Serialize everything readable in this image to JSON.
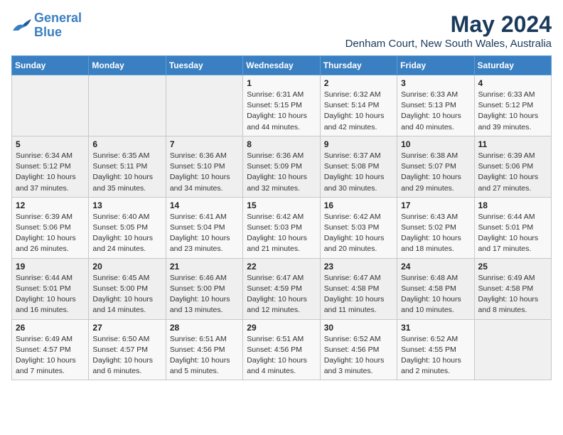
{
  "logo": {
    "line1": "General",
    "line2": "Blue"
  },
  "title": "May 2024",
  "location": "Denham Court, New South Wales, Australia",
  "days_of_week": [
    "Sunday",
    "Monday",
    "Tuesday",
    "Wednesday",
    "Thursday",
    "Friday",
    "Saturday"
  ],
  "weeks": [
    [
      {
        "day": "",
        "info": ""
      },
      {
        "day": "",
        "info": ""
      },
      {
        "day": "",
        "info": ""
      },
      {
        "day": "1",
        "info": "Sunrise: 6:31 AM\nSunset: 5:15 PM\nDaylight: 10 hours\nand 44 minutes."
      },
      {
        "day": "2",
        "info": "Sunrise: 6:32 AM\nSunset: 5:14 PM\nDaylight: 10 hours\nand 42 minutes."
      },
      {
        "day": "3",
        "info": "Sunrise: 6:33 AM\nSunset: 5:13 PM\nDaylight: 10 hours\nand 40 minutes."
      },
      {
        "day": "4",
        "info": "Sunrise: 6:33 AM\nSunset: 5:12 PM\nDaylight: 10 hours\nand 39 minutes."
      }
    ],
    [
      {
        "day": "5",
        "info": "Sunrise: 6:34 AM\nSunset: 5:12 PM\nDaylight: 10 hours\nand 37 minutes."
      },
      {
        "day": "6",
        "info": "Sunrise: 6:35 AM\nSunset: 5:11 PM\nDaylight: 10 hours\nand 35 minutes."
      },
      {
        "day": "7",
        "info": "Sunrise: 6:36 AM\nSunset: 5:10 PM\nDaylight: 10 hours\nand 34 minutes."
      },
      {
        "day": "8",
        "info": "Sunrise: 6:36 AM\nSunset: 5:09 PM\nDaylight: 10 hours\nand 32 minutes."
      },
      {
        "day": "9",
        "info": "Sunrise: 6:37 AM\nSunset: 5:08 PM\nDaylight: 10 hours\nand 30 minutes."
      },
      {
        "day": "10",
        "info": "Sunrise: 6:38 AM\nSunset: 5:07 PM\nDaylight: 10 hours\nand 29 minutes."
      },
      {
        "day": "11",
        "info": "Sunrise: 6:39 AM\nSunset: 5:06 PM\nDaylight: 10 hours\nand 27 minutes."
      }
    ],
    [
      {
        "day": "12",
        "info": "Sunrise: 6:39 AM\nSunset: 5:06 PM\nDaylight: 10 hours\nand 26 minutes."
      },
      {
        "day": "13",
        "info": "Sunrise: 6:40 AM\nSunset: 5:05 PM\nDaylight: 10 hours\nand 24 minutes."
      },
      {
        "day": "14",
        "info": "Sunrise: 6:41 AM\nSunset: 5:04 PM\nDaylight: 10 hours\nand 23 minutes."
      },
      {
        "day": "15",
        "info": "Sunrise: 6:42 AM\nSunset: 5:03 PM\nDaylight: 10 hours\nand 21 minutes."
      },
      {
        "day": "16",
        "info": "Sunrise: 6:42 AM\nSunset: 5:03 PM\nDaylight: 10 hours\nand 20 minutes."
      },
      {
        "day": "17",
        "info": "Sunrise: 6:43 AM\nSunset: 5:02 PM\nDaylight: 10 hours\nand 18 minutes."
      },
      {
        "day": "18",
        "info": "Sunrise: 6:44 AM\nSunset: 5:01 PM\nDaylight: 10 hours\nand 17 minutes."
      }
    ],
    [
      {
        "day": "19",
        "info": "Sunrise: 6:44 AM\nSunset: 5:01 PM\nDaylight: 10 hours\nand 16 minutes."
      },
      {
        "day": "20",
        "info": "Sunrise: 6:45 AM\nSunset: 5:00 PM\nDaylight: 10 hours\nand 14 minutes."
      },
      {
        "day": "21",
        "info": "Sunrise: 6:46 AM\nSunset: 5:00 PM\nDaylight: 10 hours\nand 13 minutes."
      },
      {
        "day": "22",
        "info": "Sunrise: 6:47 AM\nSunset: 4:59 PM\nDaylight: 10 hours\nand 12 minutes."
      },
      {
        "day": "23",
        "info": "Sunrise: 6:47 AM\nSunset: 4:58 PM\nDaylight: 10 hours\nand 11 minutes."
      },
      {
        "day": "24",
        "info": "Sunrise: 6:48 AM\nSunset: 4:58 PM\nDaylight: 10 hours\nand 10 minutes."
      },
      {
        "day": "25",
        "info": "Sunrise: 6:49 AM\nSunset: 4:58 PM\nDaylight: 10 hours\nand 8 minutes."
      }
    ],
    [
      {
        "day": "26",
        "info": "Sunrise: 6:49 AM\nSunset: 4:57 PM\nDaylight: 10 hours\nand 7 minutes."
      },
      {
        "day": "27",
        "info": "Sunrise: 6:50 AM\nSunset: 4:57 PM\nDaylight: 10 hours\nand 6 minutes."
      },
      {
        "day": "28",
        "info": "Sunrise: 6:51 AM\nSunset: 4:56 PM\nDaylight: 10 hours\nand 5 minutes."
      },
      {
        "day": "29",
        "info": "Sunrise: 6:51 AM\nSunset: 4:56 PM\nDaylight: 10 hours\nand 4 minutes."
      },
      {
        "day": "30",
        "info": "Sunrise: 6:52 AM\nSunset: 4:56 PM\nDaylight: 10 hours\nand 3 minutes."
      },
      {
        "day": "31",
        "info": "Sunrise: 6:52 AM\nSunset: 4:55 PM\nDaylight: 10 hours\nand 2 minutes."
      },
      {
        "day": "",
        "info": ""
      }
    ]
  ]
}
